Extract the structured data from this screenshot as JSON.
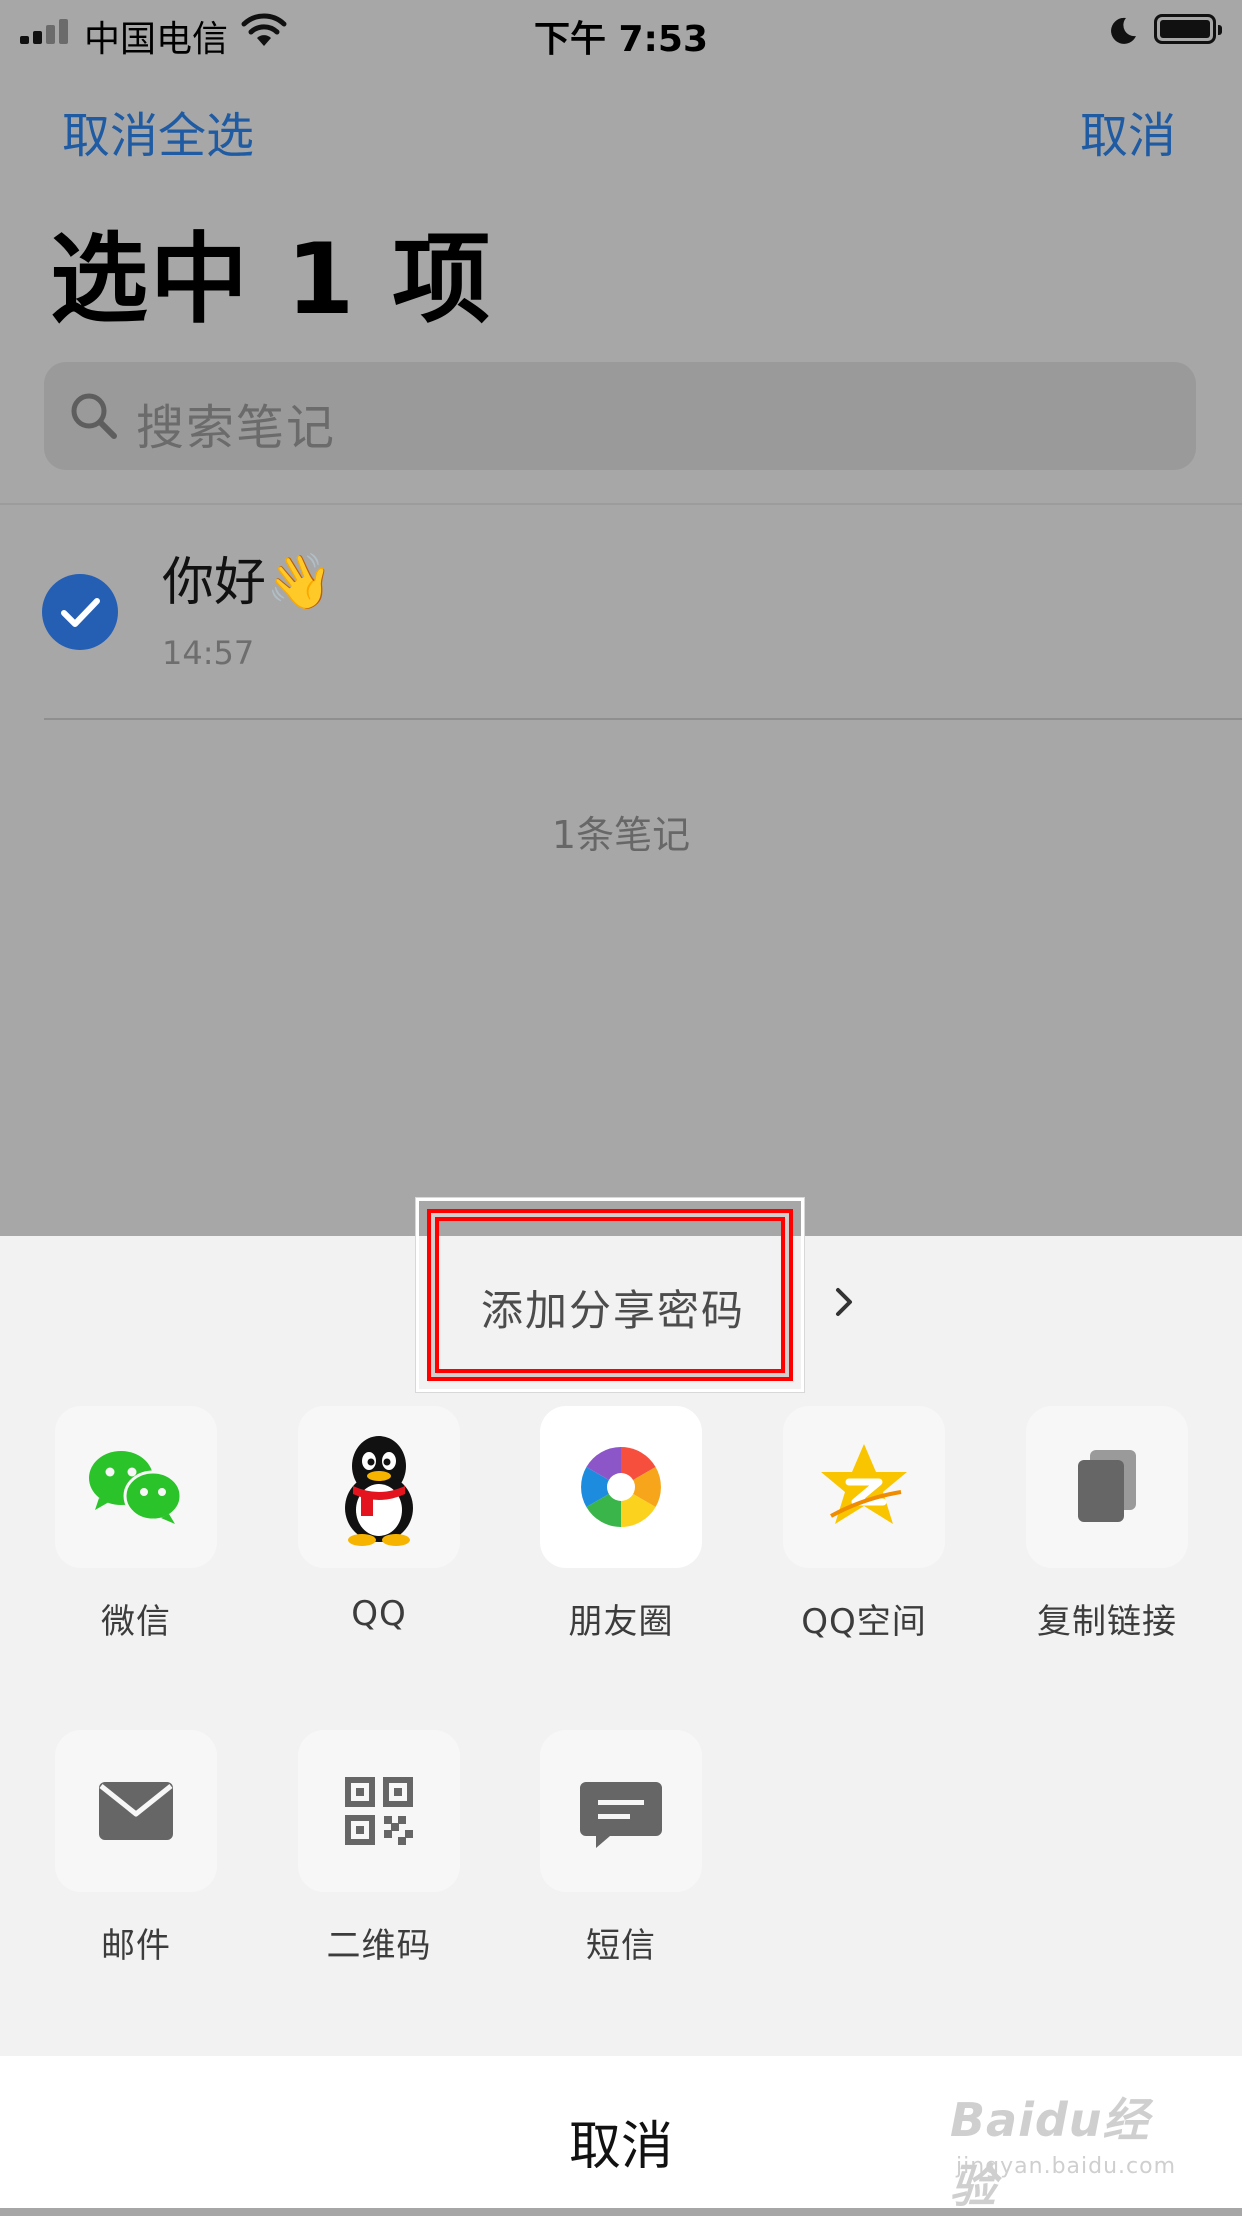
{
  "status_bar": {
    "carrier": "中国电信",
    "time": "下午 7:53"
  },
  "nav": {
    "left_label": "取消全选",
    "right_label": "取消"
  },
  "page": {
    "title": "选中 1 项"
  },
  "search": {
    "placeholder": "搜索笔记"
  },
  "notes": [
    {
      "title": "你好",
      "emoji": "👋",
      "time": "14:57",
      "selected": true
    }
  ],
  "note_count": "1条笔记",
  "share_sheet": {
    "password_option": "添加分享密码",
    "row1": [
      {
        "label": "微信",
        "icon": "wechat-icon"
      },
      {
        "label": "QQ",
        "icon": "qq-penguin-icon"
      },
      {
        "label": "朋友圈",
        "icon": "moments-icon"
      },
      {
        "label": "QQ空间",
        "icon": "qzone-star-icon"
      },
      {
        "label": "复制链接",
        "icon": "copy-link-icon"
      }
    ],
    "row2": [
      {
        "label": "邮件",
        "icon": "mail-icon"
      },
      {
        "label": "二维码",
        "icon": "qr-code-icon"
      },
      {
        "label": "短信",
        "icon": "sms-icon"
      }
    ],
    "cancel_label": "取消"
  },
  "watermark": {
    "logo": "Baidu经验",
    "url": "jingyan.baidu.com"
  },
  "colors": {
    "accent_blue": "#1f5ba3",
    "highlight_red": "#ff0000",
    "wechat_green": "#2bc32a"
  }
}
